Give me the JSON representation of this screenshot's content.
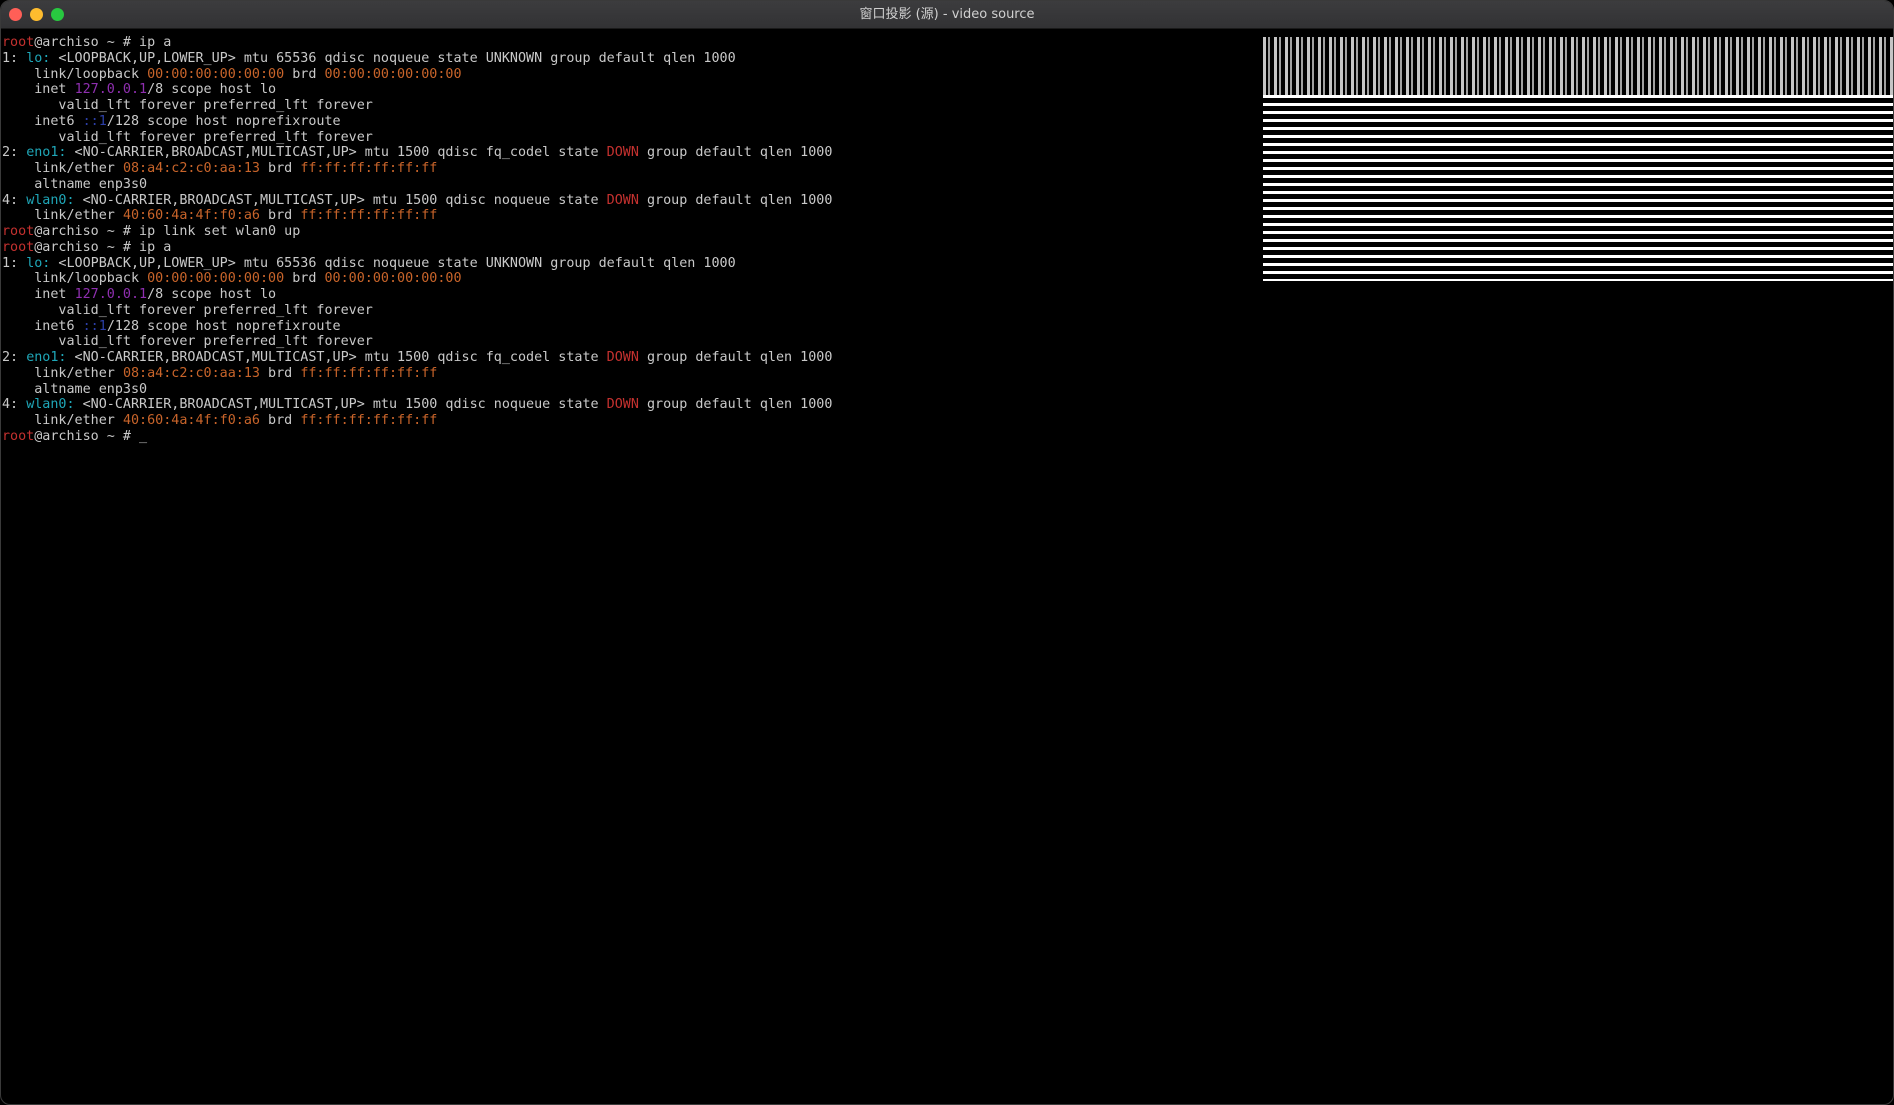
{
  "window": {
    "title": "窗口投影 (源) - video source",
    "controls": {
      "close_color": "#ff5f57",
      "minimize_color": "#febc2e",
      "maximize_color": "#28c840"
    }
  },
  "terminal": {
    "lines": [
      [
        {
          "t": "root",
          "c": "red"
        },
        {
          "t": "@archiso ~ # ip a"
        }
      ],
      [
        {
          "t": "1: "
        },
        {
          "t": "lo:",
          "c": "cyan"
        },
        {
          "t": " <LOOPBACK,UP,LOWER_UP> mtu 65536 qdisc noqueue state UNKNOWN group default qlen 1000"
        }
      ],
      [
        {
          "t": "    link/loopback "
        },
        {
          "t": "00:00:00:00:00:00",
          "c": "orange"
        },
        {
          "t": " brd "
        },
        {
          "t": "00:00:00:00:00:00",
          "c": "orange"
        }
      ],
      [
        {
          "t": "    inet "
        },
        {
          "t": "127.0.0.1",
          "c": "magenta"
        },
        {
          "t": "/8 scope host lo"
        }
      ],
      [
        {
          "t": "       valid_lft forever preferred_lft forever"
        }
      ],
      [
        {
          "t": "    inet6 "
        },
        {
          "t": "::1",
          "c": "blue"
        },
        {
          "t": "/128 scope host noprefixroute"
        }
      ],
      [
        {
          "t": "       valid_lft forever preferred_lft forever"
        }
      ],
      [
        {
          "t": "2: "
        },
        {
          "t": "eno1:",
          "c": "cyan"
        },
        {
          "t": " <NO-CARRIER,BROADCAST,MULTICAST,UP> mtu 1500 qdisc fq_codel state "
        },
        {
          "t": "DOWN",
          "c": "red"
        },
        {
          "t": " group default qlen 1000"
        }
      ],
      [
        {
          "t": "    link/ether "
        },
        {
          "t": "08:a4:c2:c0:aa:13",
          "c": "orange"
        },
        {
          "t": " brd "
        },
        {
          "t": "ff:ff:ff:ff:ff:ff",
          "c": "orange"
        }
      ],
      [
        {
          "t": "    altname enp3s0"
        }
      ],
      [
        {
          "t": "4: "
        },
        {
          "t": "wlan0:",
          "c": "cyan"
        },
        {
          "t": " <NO-CARRIER,BROADCAST,MULTICAST,UP> mtu 1500 qdisc noqueue state "
        },
        {
          "t": "DOWN",
          "c": "red"
        },
        {
          "t": " group default qlen 1000"
        }
      ],
      [
        {
          "t": "    link/ether "
        },
        {
          "t": "40:60:4a:4f:f0:a6",
          "c": "orange"
        },
        {
          "t": " brd "
        },
        {
          "t": "ff:ff:ff:ff:ff:ff",
          "c": "orange"
        }
      ],
      [
        {
          "t": "root",
          "c": "red"
        },
        {
          "t": "@archiso ~ # ip link set wlan0 up"
        }
      ],
      [
        {
          "t": "root",
          "c": "red"
        },
        {
          "t": "@archiso ~ # ip a"
        }
      ],
      [
        {
          "t": "1: "
        },
        {
          "t": "lo:",
          "c": "cyan"
        },
        {
          "t": " <LOOPBACK,UP,LOWER_UP> mtu 65536 qdisc noqueue state UNKNOWN group default qlen 1000"
        }
      ],
      [
        {
          "t": "    link/loopback "
        },
        {
          "t": "00:00:00:00:00:00",
          "c": "orange"
        },
        {
          "t": " brd "
        },
        {
          "t": "00:00:00:00:00:00",
          "c": "orange"
        }
      ],
      [
        {
          "t": "    inet "
        },
        {
          "t": "127.0.0.1",
          "c": "magenta"
        },
        {
          "t": "/8 scope host lo"
        }
      ],
      [
        {
          "t": "       valid_lft forever preferred_lft forever"
        }
      ],
      [
        {
          "t": "    inet6 "
        },
        {
          "t": "::1",
          "c": "blue"
        },
        {
          "t": "/128 scope host noprefixroute"
        }
      ],
      [
        {
          "t": "       valid_lft forever preferred_lft forever"
        }
      ],
      [
        {
          "t": "2: "
        },
        {
          "t": "eno1:",
          "c": "cyan"
        },
        {
          "t": " <NO-CARRIER,BROADCAST,MULTICAST,UP> mtu 1500 qdisc fq_codel state "
        },
        {
          "t": "DOWN",
          "c": "red"
        },
        {
          "t": " group default qlen 1000"
        }
      ],
      [
        {
          "t": "    link/ether "
        },
        {
          "t": "08:a4:c2:c0:aa:13",
          "c": "orange"
        },
        {
          "t": " brd "
        },
        {
          "t": "ff:ff:ff:ff:ff:ff",
          "c": "orange"
        }
      ],
      [
        {
          "t": "    altname enp3s0"
        }
      ],
      [
        {
          "t": "4: "
        },
        {
          "t": "wlan0:",
          "c": "cyan"
        },
        {
          "t": " <NO-CARRIER,BROADCAST,MULTICAST,UP> mtu 1500 qdisc noqueue state "
        },
        {
          "t": "DOWN",
          "c": "red"
        },
        {
          "t": " group default qlen 1000"
        }
      ],
      [
        {
          "t": "    link/ether "
        },
        {
          "t": "40:60:4a:4f:f0:a6",
          "c": "orange"
        },
        {
          "t": " brd "
        },
        {
          "t": "ff:ff:ff:ff:ff:ff",
          "c": "orange"
        }
      ],
      [
        {
          "t": "root",
          "c": "red"
        },
        {
          "t": "@archiso ~ # _"
        }
      ]
    ]
  },
  "colors": {
    "background": "#000000",
    "text": "#c9c9c9",
    "red": "#c4312f",
    "cyan": "#1fa7b8",
    "orange": "#c8642a",
    "magenta": "#8f2fb0",
    "blue": "#2c3fa8"
  }
}
